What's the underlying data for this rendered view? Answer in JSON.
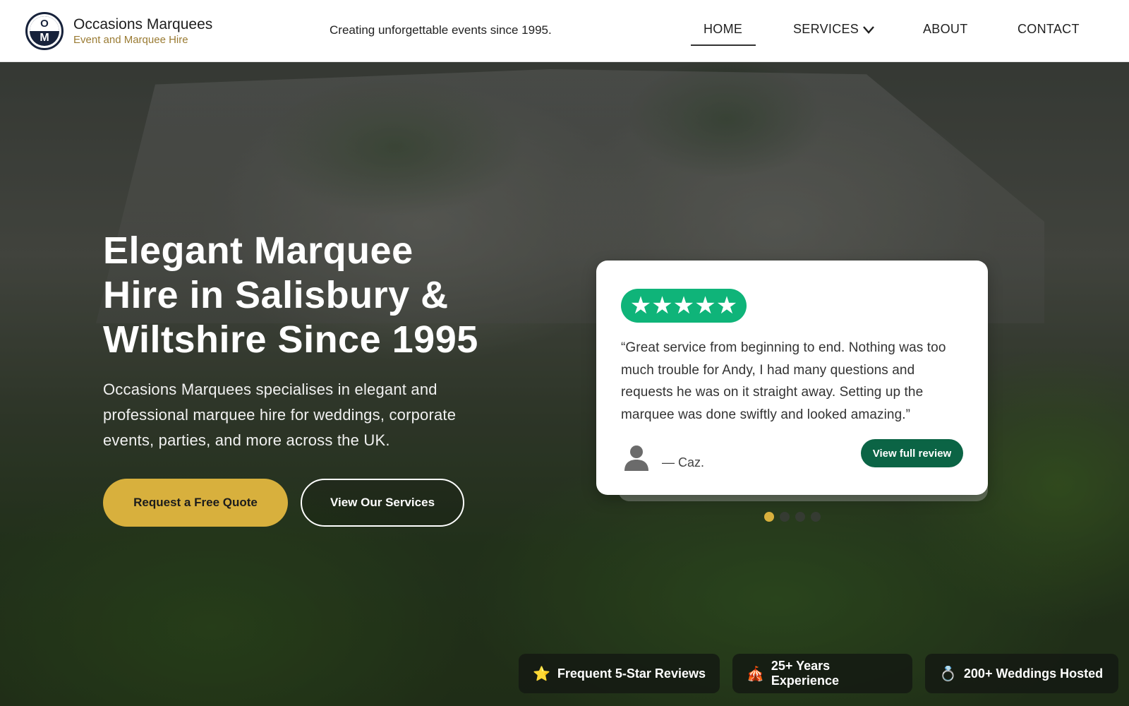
{
  "header": {
    "brand_name": "Occasions Marquees",
    "brand_tagline": "Event and Marquee Hire",
    "logo_letters": {
      "top": "O",
      "bottom": "M"
    },
    "tagline": "Creating unforgettable events since 1995.",
    "nav": [
      {
        "label": "HOME",
        "active": true
      },
      {
        "label": "SERVICES",
        "has_dropdown": true
      },
      {
        "label": "ABOUT"
      },
      {
        "label": "CONTACT"
      }
    ]
  },
  "hero": {
    "title": "Elegant Marquee Hire in Salisbury & Wiltshire Since 1995",
    "subtitle": "Occasions Marquees specialises in elegant and professional marquee hire for weddings, corporate events, parties, and more across the UK.",
    "primary_button": "Request a Free Quote",
    "secondary_button": "View Our Services"
  },
  "review": {
    "stars": "★★★★★",
    "rating": 5,
    "quote": "“Great service from beginning to end. Nothing was too much trouble for Andy, I had many questions and requests he was on it straight away. Setting up the marquee was done swiftly and looked amazing.”",
    "author": "— Caz.",
    "button": "View full review",
    "carousel": {
      "count": 4,
      "active_index": 0
    }
  },
  "badges": [
    {
      "icon": "star-icon",
      "glyph": "⭐",
      "label": "Frequent 5-Star Reviews"
    },
    {
      "icon": "circus-tent-icon",
      "glyph": "🎪",
      "label": "25+ Years Experience"
    },
    {
      "icon": "ring-icon",
      "glyph": "💍",
      "label": "200+ Weddings Hosted"
    }
  ],
  "colors": {
    "accent_gold": "#d8b03d",
    "navy": "#17223b",
    "trustpilot_green": "#0fb479",
    "review_button_green": "#0b6445"
  }
}
